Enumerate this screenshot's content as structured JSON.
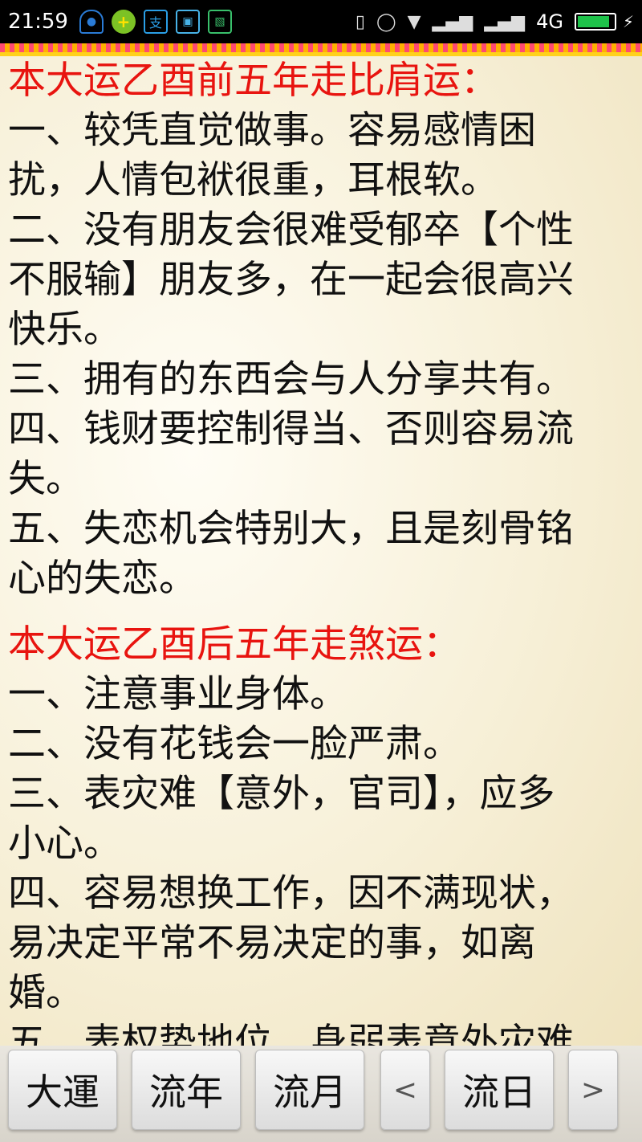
{
  "status_bar": {
    "time": "21:59",
    "network": "4G",
    "battery_percent": 90
  },
  "sections": [
    {
      "heading": "本大运乙酉前五年走比肩运：",
      "lines": [
        "一、较凭直觉做事。容易感情困",
        "扰，人情包袱很重，耳根软。",
        "二、没有朋友会很难受郁卒【个性",
        "不服输】朋友多，在一起会很高兴",
        "快乐。",
        "三、拥有的东西会与人分享共有。",
        "四、钱财要控制得当、否则容易流",
        "失。",
        "五、失恋机会特别大，且是刻骨铭",
        "心的失恋。"
      ]
    },
    {
      "heading": "本大运乙酉后五年走煞运：",
      "lines": [
        "一、注意事业身体。",
        "二、没有花钱会一脸严肃。",
        "三、表灾难【意外，官司】，应多",
        "小心。",
        "四、容易想换工作，因不满现状，",
        "易决定平常不易决定的事，如离",
        "婚。",
        "五、表权势地位，身弱表意外灾难"
      ]
    }
  ],
  "nav": {
    "dayun": "大運",
    "liunian": "流年",
    "liuyue": "流月",
    "prev": "<",
    "liuri": "流日",
    "next": ">"
  }
}
